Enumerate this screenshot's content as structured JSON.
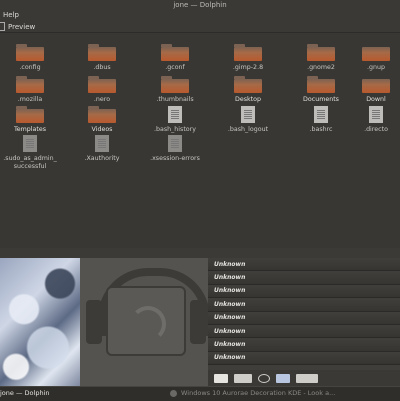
{
  "window": {
    "title": "jone — Dolphin"
  },
  "menubar": {
    "help": "Help"
  },
  "toolbar": {
    "preview": "Preview"
  },
  "files": [
    {
      "name": ".config",
      "type": "folder"
    },
    {
      "name": ".dbus",
      "type": "folder"
    },
    {
      "name": ".gconf",
      "type": "folder"
    },
    {
      "name": ".gimp-2.8",
      "type": "folder"
    },
    {
      "name": ".gnome2",
      "type": "folder"
    },
    {
      "name": ".gnup",
      "type": "folder"
    },
    {
      "name": ".mozilla",
      "type": "folder"
    },
    {
      "name": ".nero",
      "type": "folder"
    },
    {
      "name": ".thumbnails",
      "type": "folder"
    },
    {
      "name": "Desktop",
      "type": "folder"
    },
    {
      "name": "Documents",
      "type": "folder"
    },
    {
      "name": "Downl",
      "type": "folder"
    },
    {
      "name": "Templates",
      "type": "folder"
    },
    {
      "name": "Videos",
      "type": "folder"
    },
    {
      "name": ".bash_history",
      "type": "doc"
    },
    {
      "name": ".bash_logout",
      "type": "doc"
    },
    {
      "name": ".bashrc",
      "type": "doc"
    },
    {
      "name": ".directo",
      "type": "doc"
    },
    {
      "name": ".sudo_as_admin_successful",
      "line1": ".sudo_as_admin_",
      "line2": "successful",
      "type": "doc"
    },
    {
      "name": ".Xauthority",
      "type": "doc"
    },
    {
      "name": ".xsession-errors",
      "type": "doc"
    }
  ],
  "player": {
    "tracks": [
      "Unknown",
      "Unknown",
      "Unknown",
      "Unknown",
      "Unknown",
      "Unknown",
      "Unknown",
      "Unknown"
    ]
  },
  "taskbar": {
    "task1": "jone — Dolphin",
    "task2": "Windows 10 Aurorae Decoration KDE - Look a..."
  }
}
